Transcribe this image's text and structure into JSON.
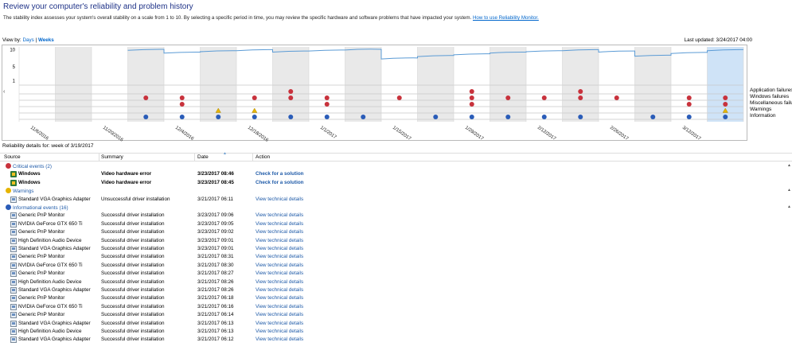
{
  "header": {
    "title": "Review your computer's reliability and problem history",
    "description": "The stability index assesses your system's overall stability on a scale from 1 to 10. By selecting a specific period in time, you may review the specific hardware and software problems that have impacted your system.",
    "help_link": "How to use Reliability Monitor."
  },
  "viewby": {
    "label": "View by:",
    "days": "Days",
    "sep": "|",
    "weeks": "Weeks"
  },
  "last_updated": "Last updated: 3/24/2017 04:00",
  "chart": {
    "y_labels": [
      "10",
      "5",
      "1"
    ],
    "x_labels": [
      "11/6/2016",
      "11/20/2016",
      "12/4/2016",
      "12/18/2016",
      "1/1/2017",
      "1/15/2017",
      "1/29/2017",
      "2/12/2017",
      "2/26/2017",
      "3/12/2017"
    ],
    "legend": [
      "Application failures",
      "Windows failures",
      "Miscellaneous failures",
      "Warnings",
      "Information"
    ],
    "colors": {
      "error": "#c8323c",
      "warning": "#e6b400",
      "info": "#2a5cb8",
      "selected": "#cfe3f7",
      "shade": "#e9e9e9",
      "line": "#5b9bd5"
    }
  },
  "chart_data": {
    "type": "line",
    "columns": 20,
    "selected_column": 19,
    "stability_index": [
      null,
      null,
      null,
      9.7,
      8.9,
      9.3,
      9.6,
      9.2,
      9.5,
      9.8,
      7.2,
      7.9,
      8.4,
      8.9,
      9.3,
      9.6,
      9.2,
      8.0,
      8.8,
      9.6
    ],
    "ylim": [
      1,
      10
    ],
    "events": {
      "application_failures": [
        7,
        12,
        15
      ],
      "windows_failures": [
        3,
        4,
        6,
        7,
        8,
        10,
        12,
        13,
        14,
        15,
        16,
        18,
        19
      ],
      "misc_failures": [
        4,
        8,
        12,
        18,
        19
      ],
      "warnings": [
        5,
        6,
        19
      ],
      "information": [
        3,
        4,
        5,
        6,
        7,
        8,
        9,
        11,
        12,
        13,
        14,
        15,
        17,
        18,
        19
      ]
    }
  },
  "details_title": "Reliability details for: week of 3/19/2017",
  "columns": {
    "source": "Source",
    "summary": "Summary",
    "date": "Date",
    "action": "Action"
  },
  "groups": {
    "critical": "Critical events (2)",
    "warnings": "Warnings",
    "info": "Informational events (16)"
  },
  "critical_rows": [
    {
      "source": "Windows",
      "summary": "Video hardware error",
      "date": "3/23/2017 08:46",
      "action": "Check for a solution"
    },
    {
      "source": "Windows",
      "summary": "Video hardware error",
      "date": "3/23/2017 08:45",
      "action": "Check for a solution"
    }
  ],
  "warning_rows": [
    {
      "source": "Standard VGA Graphics Adapter",
      "summary": "Unsuccessful driver installation",
      "date": "3/21/2017 06:11",
      "action": "View  technical details"
    }
  ],
  "info_rows": [
    {
      "source": "Generic PnP Monitor",
      "summary": "Successful driver installation",
      "date": "3/23/2017 09:06",
      "action": "View  technical details"
    },
    {
      "source": "NVIDIA GeForce GTX 650 Ti",
      "summary": "Successful driver installation",
      "date": "3/23/2017 09:05",
      "action": "View  technical details"
    },
    {
      "source": "Generic PnP Monitor",
      "summary": "Successful driver installation",
      "date": "3/23/2017 09:02",
      "action": "View  technical details"
    },
    {
      "source": "High Definition Audio Device",
      "summary": "Successful driver installation",
      "date": "3/23/2017 09:01",
      "action": "View  technical details"
    },
    {
      "source": "Standard VGA Graphics Adapter",
      "summary": "Successful driver installation",
      "date": "3/23/2017 09:01",
      "action": "View  technical details"
    },
    {
      "source": "Generic PnP Monitor",
      "summary": "Successful driver installation",
      "date": "3/21/2017 08:31",
      "action": "View  technical details"
    },
    {
      "source": "NVIDIA GeForce GTX 650 Ti",
      "summary": "Successful driver installation",
      "date": "3/21/2017 08:30",
      "action": "View  technical details"
    },
    {
      "source": "Generic PnP Monitor",
      "summary": "Successful driver installation",
      "date": "3/21/2017 08:27",
      "action": "View  technical details"
    },
    {
      "source": "High Definition Audio Device",
      "summary": "Successful driver installation",
      "date": "3/21/2017 08:26",
      "action": "View  technical details"
    },
    {
      "source": "Standard VGA Graphics Adapter",
      "summary": "Successful driver installation",
      "date": "3/21/2017 08:26",
      "action": "View  technical details"
    },
    {
      "source": "Generic PnP Monitor",
      "summary": "Successful driver installation",
      "date": "3/21/2017 06:18",
      "action": "View  technical details"
    },
    {
      "source": "NVIDIA GeForce GTX 650 Ti",
      "summary": "Successful driver installation",
      "date": "3/21/2017 06:16",
      "action": "View  technical details"
    },
    {
      "source": "Generic PnP Monitor",
      "summary": "Successful driver installation",
      "date": "3/21/2017 06:14",
      "action": "View  technical details"
    },
    {
      "source": "Standard VGA Graphics Adapter",
      "summary": "Successful driver installation",
      "date": "3/21/2017 06:13",
      "action": "View  technical details"
    },
    {
      "source": "High Definition Audio Device",
      "summary": "Successful driver installation",
      "date": "3/21/2017 06:13",
      "action": "View  technical details"
    },
    {
      "source": "Standard VGA Graphics Adapter",
      "summary": "Successful driver installation",
      "date": "3/21/2017 06:12",
      "action": "View  technical details"
    }
  ]
}
